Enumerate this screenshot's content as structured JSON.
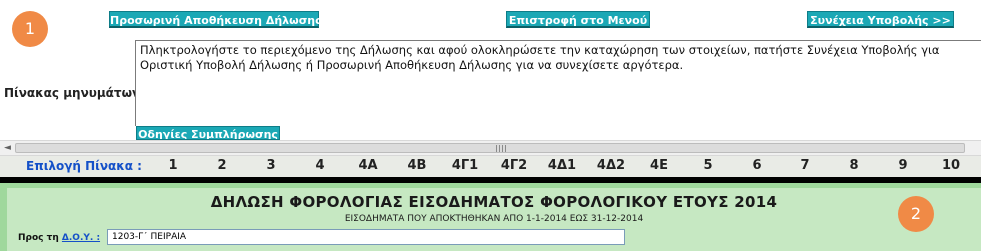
{
  "toolbar": {
    "temp_save_label": "Προσωρινή Αποθήκευση Δήλωσης",
    "menu_label": "Επιστροφή στο Μενού",
    "continue_label": "Συνέχεια Υποβολής >>"
  },
  "badges": {
    "first": "1",
    "second": "2"
  },
  "messages": {
    "label": "Πίνακας μηνυμάτων :",
    "text": "Πληκτρολογήστε το περιεχόμενο της Δήλωσης και αφού ολοκληρώσετε την καταχώρηση των στοιχείων, πατήστε Συνέχεια Υποβολής για Οριστική Υποβολή Δήλωσης ή Προσωρινή Αποθήκευση Δήλωσης για να συνεχίσετε αργότερα.",
    "guide_label": "Οδηγίες Συμπλήρωσης"
  },
  "scrollbar": {
    "left_arrow": "◄"
  },
  "tables": {
    "label": "Επιλογή Πίνακα :",
    "items": [
      "1",
      "2",
      "3",
      "4",
      "4Α",
      "4Β",
      "4Γ1",
      "4Γ2",
      "4Δ1",
      "4Δ2",
      "4Ε",
      "5",
      "6",
      "7",
      "8",
      "9",
      "10"
    ]
  },
  "form": {
    "title": "ΔΗΛΩΣΗ ΦΟΡΟΛΟΓΙΑΣ ΕΙΣΟΔΗΜΑΤΟΣ ΦΟΡΟΛΟΓΙΚΟΥ ΕΤΟΥΣ 2014",
    "subtitle": "ΕΙΣΟΔΗΜΑΤΑ ΠΟΥ ΑΠΟΚΤΗΘΗΚΑΝ ΑΠΟ 1-1-2014 ΕΩΣ 31-12-2014",
    "doy_prefix": "Προς τη ",
    "doy_link": "Δ.Ο.Υ. :",
    "doy_value": "1203-Γ΄ ΠΕΙΡΑΙΑ"
  },
  "colors": {
    "accent": "#1ba8b5",
    "badge": "#f08a46",
    "form_green": "#9fd89c",
    "link": "#1450c8"
  }
}
